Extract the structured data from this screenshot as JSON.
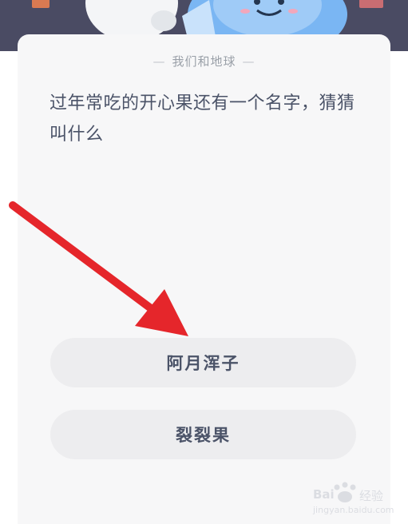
{
  "quiz": {
    "category": "我们和地球",
    "question": "过年常吃的开心果还有一个名字，猜猜叫什么",
    "options": [
      "阿月浑子",
      "裂裂果"
    ]
  },
  "watermark": {
    "brand": "Bai",
    "brand_suffix": "经验",
    "url": "jingyan.baidu.com"
  },
  "colors": {
    "arrow": "#e5262b",
    "header_bg": "#4a4b63",
    "card_bg": "#f7f7f8",
    "option_bg": "#ededef",
    "text": "#4b5368"
  }
}
